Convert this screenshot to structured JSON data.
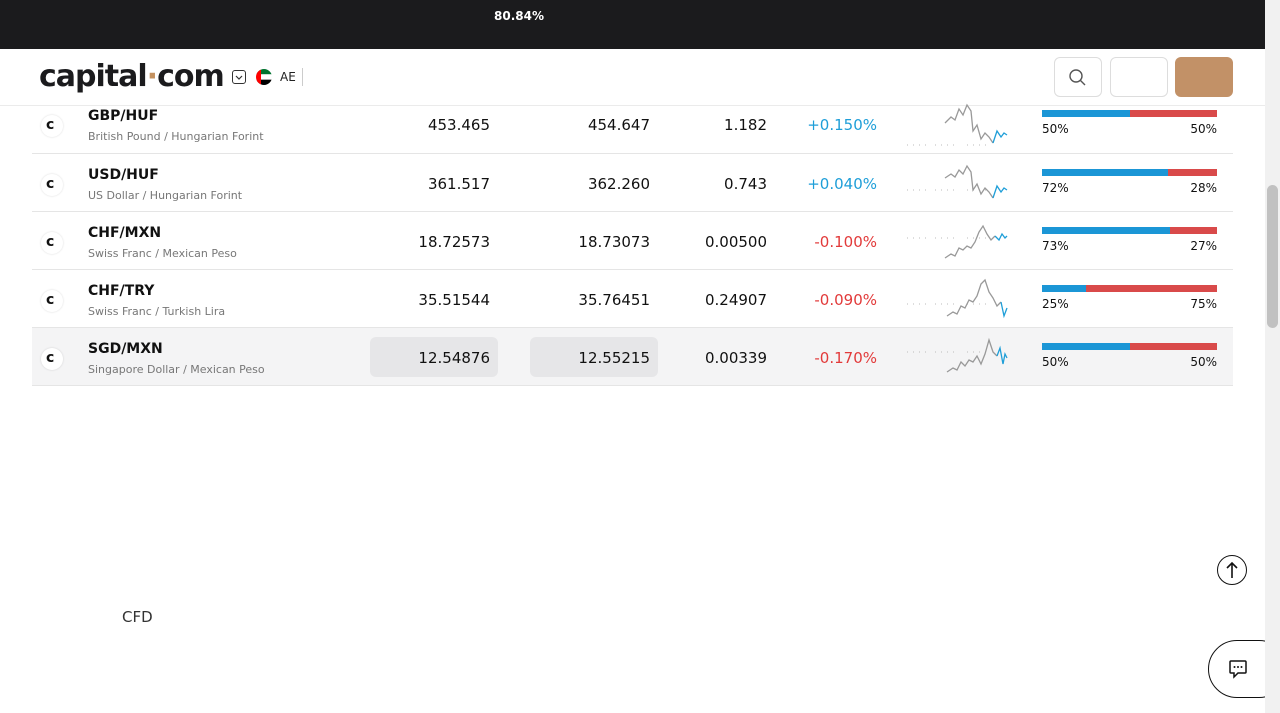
{
  "top_banner": {
    "percent": "80.84%"
  },
  "header": {
    "logo_text": "capital",
    "logo_dot": "·",
    "logo_tld": "com",
    "region": "AE"
  },
  "instruments": [
    {
      "symbol": "GBP/HUF",
      "name": "British Pound / Hungarian Forint",
      "sell": "453.465",
      "buy": "454.647",
      "spread": "1.182",
      "change": "+0.150%",
      "change_dir": "pos",
      "buyers_pct": 50,
      "buyers_label": "50%",
      "sellers_label": "50%"
    },
    {
      "symbol": "USD/HUF",
      "name": "US Dollar / Hungarian Forint",
      "sell": "361.517",
      "buy": "362.260",
      "spread": "0.743",
      "change": "+0.040%",
      "change_dir": "pos",
      "buyers_pct": 72,
      "buyers_label": "72%",
      "sellers_label": "28%"
    },
    {
      "symbol": "CHF/MXN",
      "name": "Swiss Franc / Mexican Peso",
      "sell": "18.72573",
      "buy": "18.73073",
      "spread": "0.00500",
      "change": "-0.100%",
      "change_dir": "neg",
      "buyers_pct": 73,
      "buyers_label": "73%",
      "sellers_label": "27%"
    },
    {
      "symbol": "CHF/TRY",
      "name": "Swiss Franc / Turkish Lira",
      "sell": "35.51544",
      "buy": "35.76451",
      "spread": "0.24907",
      "change": "-0.090%",
      "change_dir": "neg",
      "buyers_pct": 25,
      "buyers_label": "25%",
      "sellers_label": "75%"
    },
    {
      "symbol": "SGD/MXN",
      "name": "Singapore Dollar / Mexican Peso",
      "sell": "12.54876",
      "buy": "12.55215",
      "spread": "0.00339",
      "change": "-0.170%",
      "change_dir": "neg",
      "buyers_pct": 50,
      "buyers_label": "50%",
      "sellers_label": "50%"
    }
  ],
  "footer": {
    "cfd_label": "CFD"
  },
  "colors": {
    "buy_blue": "#1b96d6",
    "sell_red": "#d94a4a",
    "positive": "#1e9ed8",
    "negative": "#e23a3a",
    "brand_bronze": "#c29167"
  },
  "icons": {
    "search": "search-icon",
    "scroll_top": "arrow-up-icon",
    "chat": "chat-icon"
  }
}
